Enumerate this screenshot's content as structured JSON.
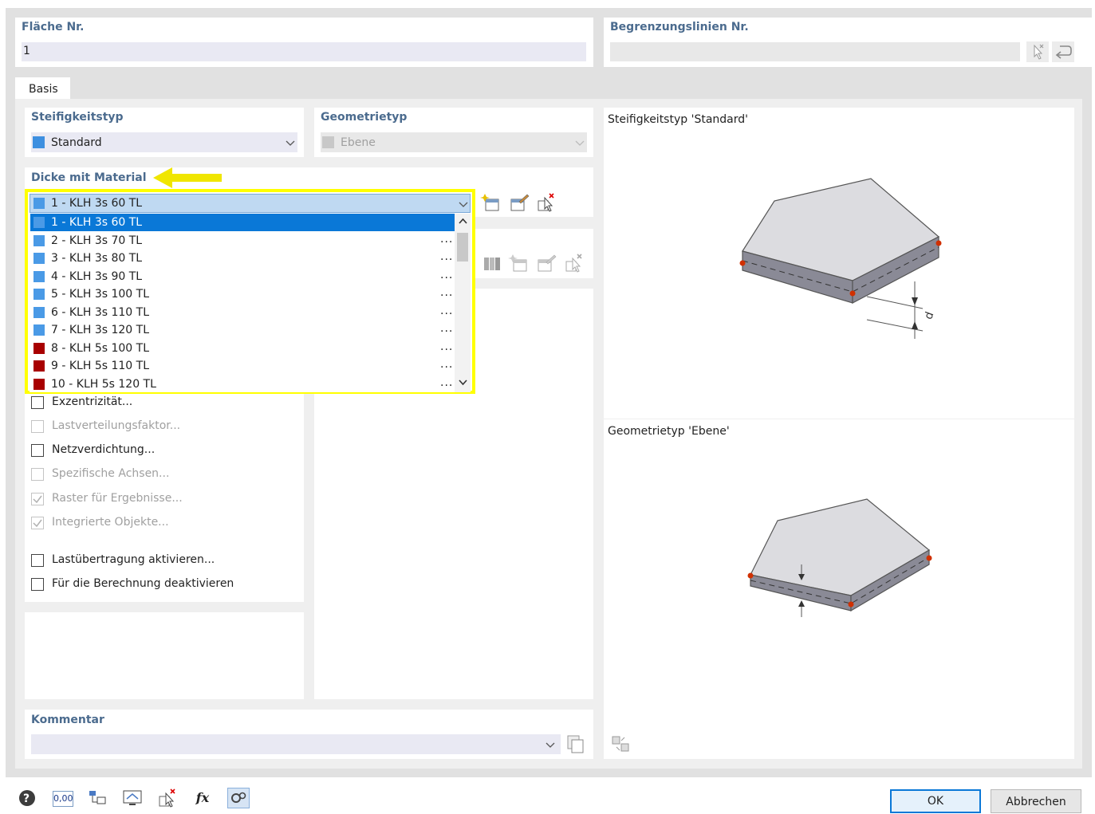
{
  "surface_no": {
    "title": "Fläche Nr.",
    "value": "1"
  },
  "boundary_lines": {
    "title": "Begrenzungslinien Nr.",
    "value": ""
  },
  "tabs": [
    {
      "label": "Basis"
    }
  ],
  "stiffness": {
    "title": "Steifigkeitstyp",
    "value": "Standard",
    "swatch": "#3d8fe0"
  },
  "geometry": {
    "title": "Geometrietyp",
    "value": "Ebene",
    "swatch": "#c8c8c8"
  },
  "thickness": {
    "title": "Dicke mit Material",
    "selected": "1 - KLH 3s 60 TL",
    "options": [
      {
        "label": "1 - KLH 3s 60 TL",
        "color": "#4a9ae6",
        "highlighted": true
      },
      {
        "label": "2 - KLH 3s 70 TL",
        "color": "#4a9ae6"
      },
      {
        "label": "3 - KLH 3s 80 TL",
        "color": "#4a9ae6"
      },
      {
        "label": "4 - KLH 3s 90 TL",
        "color": "#4a9ae6"
      },
      {
        "label": "5 - KLH 3s 100 TL",
        "color": "#4a9ae6"
      },
      {
        "label": "6 - KLH 3s 110 TL",
        "color": "#4a9ae6"
      },
      {
        "label": "7 - KLH 3s 120 TL",
        "color": "#4a9ae6"
      },
      {
        "label": "8 - KLH 5s 100 TL",
        "color": "#a80000"
      },
      {
        "label": "9 - KLH 5s 110 TL",
        "color": "#a80000"
      },
      {
        "label": "10 - KLH 5s 120 TL",
        "color": "#a80000"
      }
    ],
    "dots": "..."
  },
  "options": [
    {
      "label": "Exzentrizität...",
      "enabled": true,
      "checked": false
    },
    {
      "label": "Lastverteilungsfaktor...",
      "enabled": false,
      "checked": false
    },
    {
      "label": "Netzverdichtung...",
      "enabled": true,
      "checked": false
    },
    {
      "label": "Spezifische Achsen...",
      "enabled": false,
      "checked": false
    },
    {
      "label": "Raster für Ergebnisse...",
      "enabled": false,
      "checked": true
    },
    {
      "label": "Integrierte Objekte...",
      "enabled": false,
      "checked": true
    },
    {
      "label": "Lastübertragung aktivieren...",
      "enabled": true,
      "checked": false
    },
    {
      "label": "Für die Berechnung deaktivieren",
      "enabled": true,
      "checked": false
    }
  ],
  "preview": {
    "stiffness_caption": "Steifigkeitstyp 'Standard'",
    "geometry_caption": "Geometrietyp 'Ebene'",
    "dim_label": "d"
  },
  "comment": {
    "title": "Kommentar",
    "value": ""
  },
  "footer": {
    "ok_label": "OK",
    "cancel_label": "Abbrechen",
    "value_icon_text": "0,00",
    "formula_icon_text": "fx"
  },
  "colors": {
    "accent_title": "#4b6b8e",
    "highlight": "#ffff00",
    "selection": "#0a78d7",
    "arrow": "#f0e600"
  }
}
